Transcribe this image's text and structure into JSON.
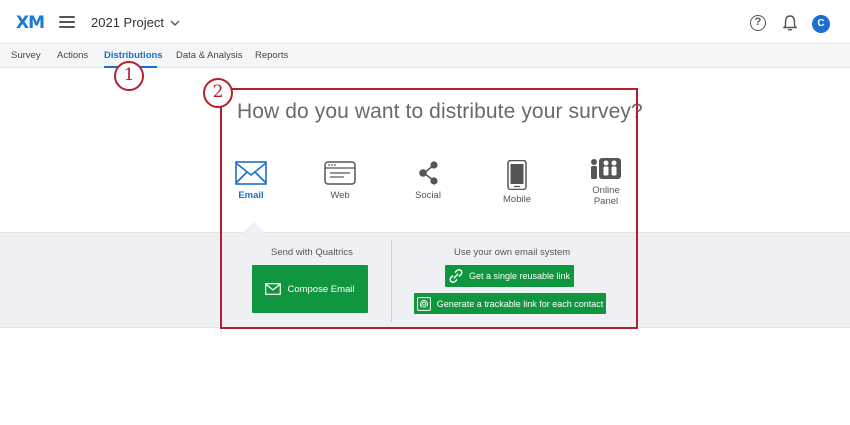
{
  "header": {
    "logo": "XM",
    "project_title": "2021 Project",
    "avatar_initial": "C"
  },
  "tabs": [
    {
      "label": "Survey",
      "active": false
    },
    {
      "label": "Actions",
      "active": false
    },
    {
      "label": "Distributions",
      "active": true
    },
    {
      "label": "Data & Analysis",
      "active": false
    },
    {
      "label": "Reports",
      "active": false
    }
  ],
  "callouts": {
    "one": "1",
    "two": "2"
  },
  "main": {
    "question": "How do you want to distribute your survey?",
    "methods": [
      {
        "label": "Email",
        "icon": "envelope-icon",
        "active": true
      },
      {
        "label": "Web",
        "icon": "browser-window-icon",
        "active": false
      },
      {
        "label": "Social",
        "icon": "share-icon",
        "active": false
      },
      {
        "label": "Mobile",
        "icon": "mobile-phone-icon",
        "active": false
      },
      {
        "label": "Online Panel",
        "icon": "people-icon",
        "active": false
      }
    ]
  },
  "email_panel": {
    "left_title": "Send with Qualtrics",
    "compose_label": "Compose Email",
    "right_title": "Use your own email system",
    "reusable_link_label": "Get a single reusable link",
    "trackable_link_label": "Generate a trackable link for each contact"
  },
  "colors": {
    "brand_blue": "#1a6fcf",
    "action_green": "#10963e",
    "callout_red": "#b5202e"
  }
}
